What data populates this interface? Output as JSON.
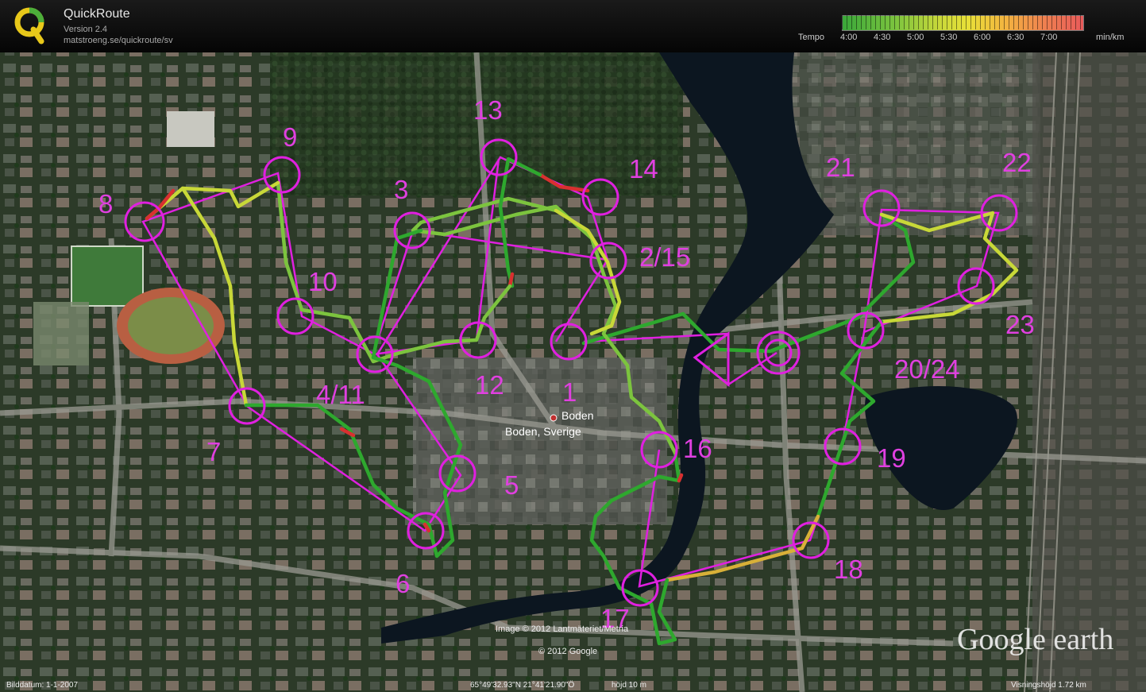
{
  "app": {
    "title": "QuickRoute",
    "version": "Version 2.4",
    "url": "matstroeng.se/quickroute/sv"
  },
  "legend": {
    "label": "Tempo",
    "ticks": [
      "4:00",
      "4:30",
      "5:00",
      "5:30",
      "6:00",
      "6:30",
      "7:00"
    ],
    "unit": "min/km"
  },
  "map": {
    "place_label": "Boden",
    "place_label_full": "Boden, Sverige",
    "imagery_credit": "Image © 2012 Lantmäteriet/Metria",
    "google_credit": "© 2012 Google",
    "brand": "Google earth"
  },
  "controls": [
    {
      "label": "1"
    },
    {
      "label": "2/15"
    },
    {
      "label": "3"
    },
    {
      "label": "4/11"
    },
    {
      "label": "5"
    },
    {
      "label": "6"
    },
    {
      "label": "7"
    },
    {
      "label": "8"
    },
    {
      "label": "9"
    },
    {
      "label": "10"
    },
    {
      "label": "12"
    },
    {
      "label": "13"
    },
    {
      "label": "14"
    },
    {
      "label": "16"
    },
    {
      "label": "17"
    },
    {
      "label": "18"
    },
    {
      "label": "19"
    },
    {
      "label": "20/24"
    },
    {
      "label": "21"
    },
    {
      "label": "22"
    },
    {
      "label": "23"
    }
  ],
  "status": {
    "date": "Bilddatum: 1-1-2007",
    "coords": "65°49'32.93\"N  21°41'21.90\"Ö",
    "elev": "höjd   10 m",
    "eye_alt": "Visningshöjd   1.72 km"
  },
  "colors": {
    "course": "#e020e0",
    "route_fast": "#2ea82e",
    "route_mid": "#d8d838",
    "route_slow": "#d83030"
  }
}
